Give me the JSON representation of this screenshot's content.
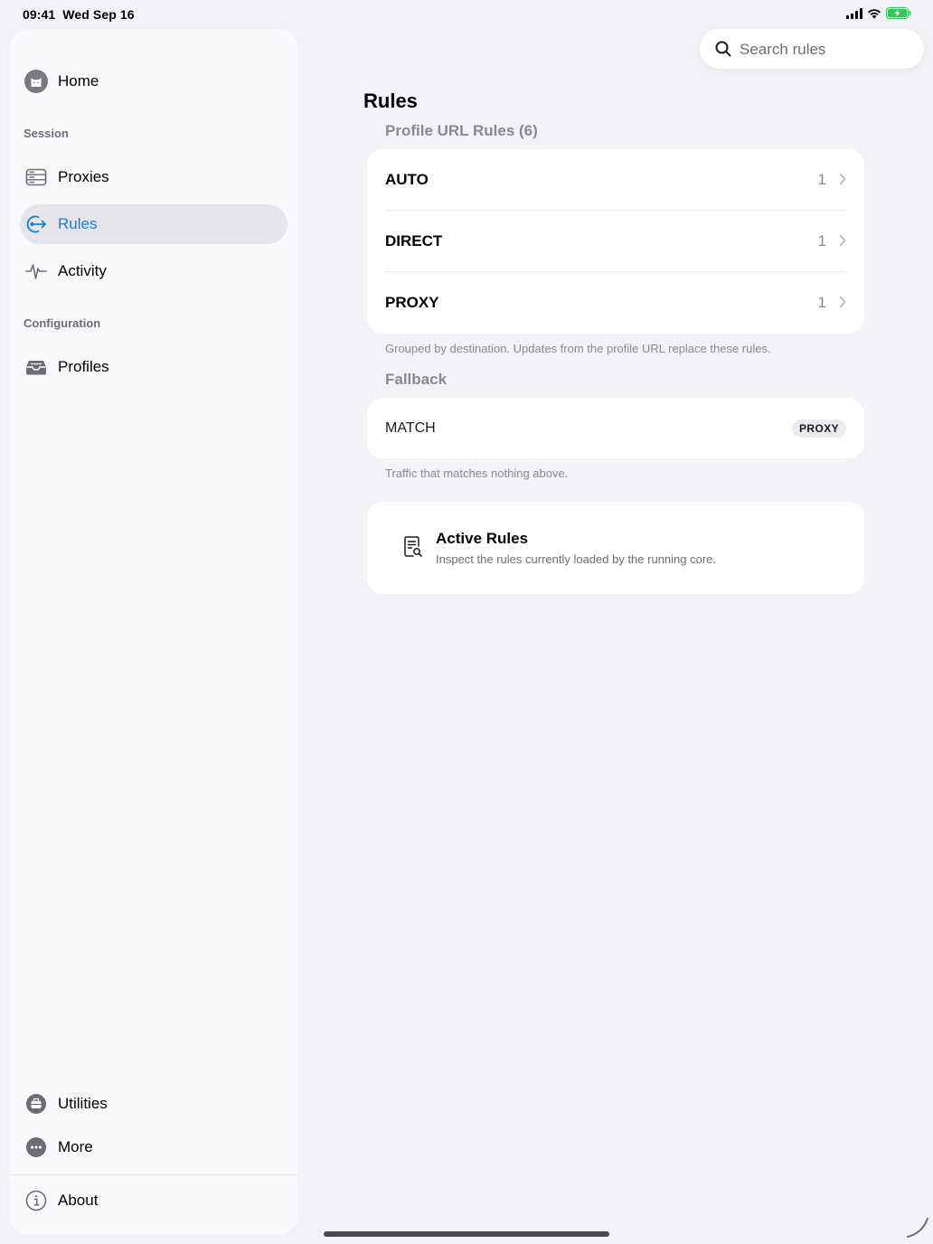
{
  "status": {
    "time": "09:41",
    "date": "Wed Sep 16"
  },
  "sidebar": {
    "home": "Home",
    "session_title": "Session",
    "proxies": "Proxies",
    "rules": "Rules",
    "activity": "Activity",
    "configuration_title": "Configuration",
    "profiles": "Profiles",
    "utilities": "Utilities",
    "more": "More",
    "about": "About"
  },
  "search": {
    "placeholder": "Search rules"
  },
  "page": {
    "title": "Rules"
  },
  "profile_rules": {
    "header": "Profile URL Rules (6)",
    "rows": [
      {
        "name": "AUTO",
        "count": "1"
      },
      {
        "name": "DIRECT",
        "count": "1"
      },
      {
        "name": "PROXY",
        "count": "1"
      }
    ],
    "footnote": "Grouped by destination. Updates from the profile URL replace these rules."
  },
  "fallback": {
    "header": "Fallback",
    "match_name": "MATCH",
    "badge": "PROXY",
    "footnote": "Traffic that matches nothing above."
  },
  "active_rules": {
    "title": "Active Rules",
    "subtitle": "Inspect the rules currently loaded by the running core."
  },
  "colors": {
    "accent": "#1a7fd6",
    "selected_bg": "#e4e4e9",
    "battery": "#34c759"
  }
}
